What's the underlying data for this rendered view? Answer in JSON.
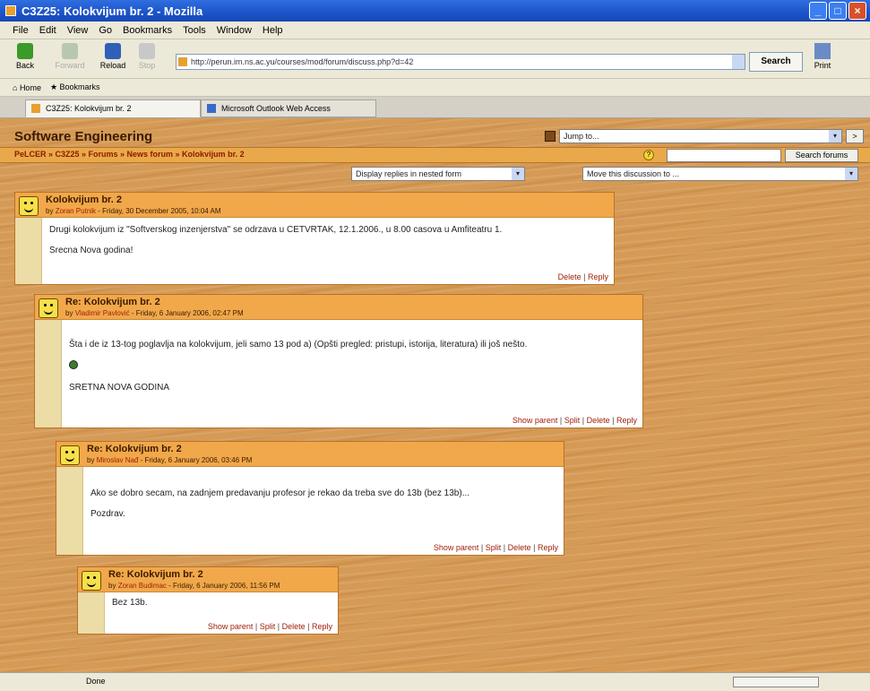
{
  "window": {
    "title": "C3Z25: Kolokvijum br. 2 - Mozilla"
  },
  "menu": [
    "File",
    "Edit",
    "View",
    "Go",
    "Bookmarks",
    "Tools",
    "Window",
    "Help"
  ],
  "toolbar": {
    "back": "Back",
    "forward": "Forward",
    "reload": "Reload",
    "stop": "Stop",
    "url": "http://perun.im.ns.ac.yu/courses/mod/forum/discuss.php?d=42",
    "search": "Search",
    "print": "Print"
  },
  "bookmarks_bar": {
    "home": "Home",
    "bookmarks": "Bookmarks"
  },
  "tabs": [
    {
      "label": "C3Z25: Kolokvijum br. 2"
    },
    {
      "label": "Microsoft Outlook Web Access"
    }
  ],
  "page": {
    "site_title": "Software Engineering",
    "jump_to": "Jump to...",
    "go": ">",
    "breadcrumb": "PeLCER » C3Z25 » Forums » News forum » Kolokvijum br. 2",
    "search_forums": "Search forums",
    "display_mode": "Display replies in nested form",
    "move_discussion": "Move this discussion to ..."
  },
  "posts": [
    {
      "subject": "Kolokvijum br. 2",
      "by": "by",
      "author": "Zoran Putnik",
      "date": "- Friday, 30 December 2005, 10:04 AM",
      "lines": [
        "Drugi kolokvijum iz \"Softverskog inzenjerstva\" se odrzava u CETVRTAK, 12.1.2006., u 8.00 casova u Amfiteatru 1.",
        "Srecna Nova godina!"
      ],
      "cmd_delete": "Delete",
      "cmd_reply": "Reply"
    },
    {
      "subject": "Re: Kolokvijum br. 2",
      "by": "by",
      "author": "Vladimir Pavlović",
      "date": "- Friday, 6 January 2006, 02:47 PM",
      "lines": [
        "Šta i de iz 13-tog poglavlja na kolokvijum, jeli samo 13 pod a) (Opšti pregled: pristupi, istorija, literatura) ili još nešto.",
        "SRETNA NOVA GODINA"
      ],
      "cmd_show_parent": "Show parent",
      "cmd_split": "Split",
      "cmd_delete": "Delete",
      "cmd_reply": "Reply"
    },
    {
      "subject": "Re: Kolokvijum br. 2",
      "by": "by",
      "author": "Miroslav Nađ",
      "date": "- Friday, 6 January 2006, 03:46 PM",
      "lines": [
        "Ako se dobro secam, na zadnjem predavanju profesor je rekao da treba sve do 13b (bez 13b)...",
        "Pozdrav."
      ],
      "cmd_show_parent": "Show parent",
      "cmd_split": "Split",
      "cmd_delete": "Delete",
      "cmd_reply": "Reply"
    },
    {
      "subject": "Re: Kolokvijum br. 2",
      "by": "by",
      "author": "Zoran Budimac",
      "date": "- Friday, 6 January 2006, 11:56 PM",
      "lines": [
        "Bez 13b."
      ],
      "cmd_show_parent": "Show parent",
      "cmd_split": "Split",
      "cmd_delete": "Delete",
      "cmd_reply": "Reply"
    }
  ],
  "status": {
    "text": "Done"
  }
}
